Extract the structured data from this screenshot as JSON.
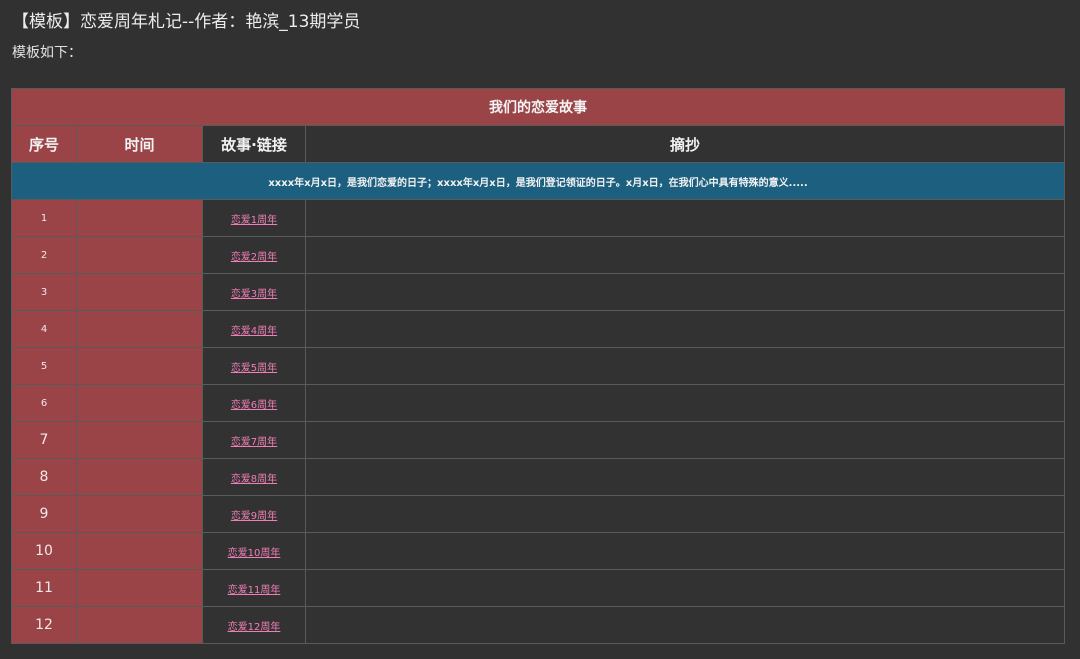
{
  "page": {
    "title": "【模板】恋爱周年札记--作者：艳滨_13期学员",
    "intro": "模板如下："
  },
  "table": {
    "caption": "我们的恋爱故事",
    "headers": {
      "index": "序号",
      "time": "时间",
      "story_link": "故事·链接",
      "excerpt": "摘抄"
    },
    "note": "xxxx年x月x日，是我们恋爱的日子；xxxx年x月x日，是我们登记领证的日子。x月x日，在我们心中具有特殊的意义.....",
    "rows": [
      {
        "index": "1",
        "time": "",
        "link": "恋爱1周年",
        "excerpt": ""
      },
      {
        "index": "2",
        "time": "",
        "link": "恋爱2周年",
        "excerpt": ""
      },
      {
        "index": "3",
        "time": "",
        "link": "恋爱3周年",
        "excerpt": ""
      },
      {
        "index": "4",
        "time": "",
        "link": "恋爱4周年",
        "excerpt": ""
      },
      {
        "index": "5",
        "time": "",
        "link": "恋爱5周年",
        "excerpt": ""
      },
      {
        "index": "6",
        "time": "",
        "link": "恋爱6周年",
        "excerpt": ""
      },
      {
        "index": "7",
        "time": "",
        "link": "恋爱7周年",
        "excerpt": ""
      },
      {
        "index": "8",
        "time": "",
        "link": "恋爱8周年",
        "excerpt": ""
      },
      {
        "index": "9",
        "time": "",
        "link": "恋爱9周年",
        "excerpt": ""
      },
      {
        "index": "10",
        "time": "",
        "link": "恋爱10周年",
        "excerpt": ""
      },
      {
        "index": "11",
        "time": "",
        "link": "恋爱11周年",
        "excerpt": ""
      },
      {
        "index": "12",
        "time": "",
        "link": "恋爱12周年",
        "excerpt": ""
      }
    ]
  },
  "colors": {
    "background": "#313131",
    "header_red": "#9b4448",
    "note_blue": "#1c5f7f",
    "link_pink": "#f07fb8"
  }
}
